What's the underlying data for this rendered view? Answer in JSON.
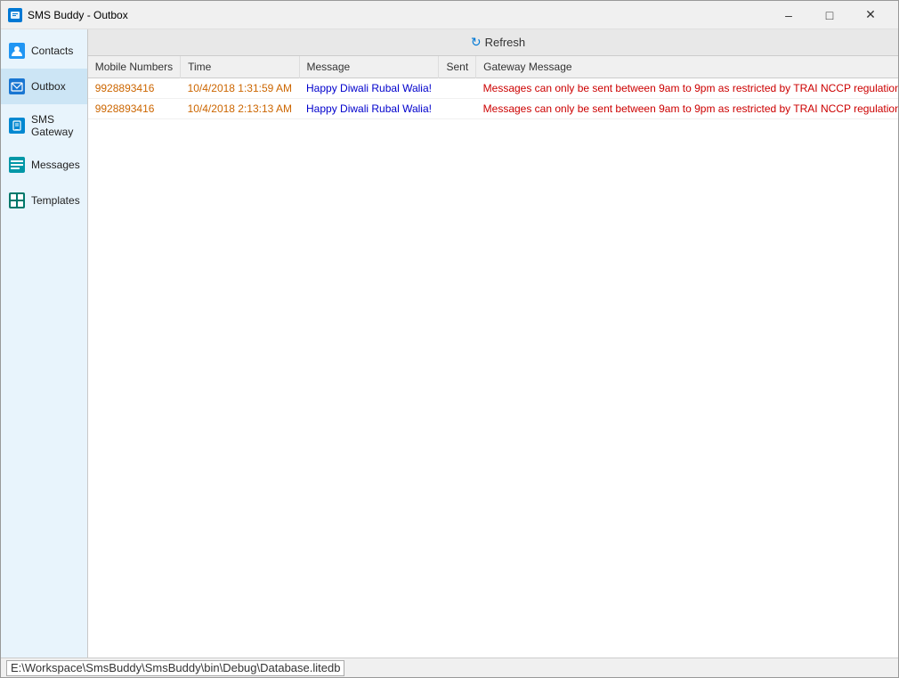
{
  "window": {
    "title": "SMS Buddy - Outbox",
    "app_name": "SMS Buddy",
    "context": "Outbox"
  },
  "title_bar": {
    "minimize_label": "–",
    "maximize_label": "□",
    "close_label": "✕"
  },
  "sidebar": {
    "items": [
      {
        "id": "contacts",
        "label": "Contacts",
        "icon": "person"
      },
      {
        "id": "outbox",
        "label": "Outbox",
        "icon": "outbox"
      },
      {
        "id": "sms-gateway",
        "label": "SMS Gateway",
        "icon": "signal"
      },
      {
        "id": "messages",
        "label": "Messages",
        "icon": "chat"
      },
      {
        "id": "templates",
        "label": "Templates",
        "icon": "grid"
      }
    ]
  },
  "toolbar": {
    "refresh_label": "Refresh"
  },
  "table": {
    "columns": [
      {
        "id": "mobile",
        "label": "Mobile Numbers"
      },
      {
        "id": "time",
        "label": "Time"
      },
      {
        "id": "message",
        "label": "Message"
      },
      {
        "id": "sent",
        "label": "Sent"
      },
      {
        "id": "gateway",
        "label": "Gateway Message"
      }
    ],
    "rows": [
      {
        "mobile": "9928893416",
        "time": "10/4/2018 1:31:59 AM",
        "message": "Happy Diwali Rubal Walia!",
        "sent": "",
        "gateway": "Messages can only be sent between 9am to 9pm as restricted by TRAI NCCP regulation"
      },
      {
        "mobile": "9928893416",
        "time": "10/4/2018 2:13:13 AM",
        "message": "Happy Diwali Rubal Walia!",
        "sent": "",
        "gateway": "Messages can only be sent between 9am to 9pm as restricted by TRAI NCCP regulation"
      }
    ]
  },
  "status_bar": {
    "path": "E:\\Workspace\\SmsBuddy\\SmsBuddy\\bin\\Debug\\Database.litedb"
  }
}
